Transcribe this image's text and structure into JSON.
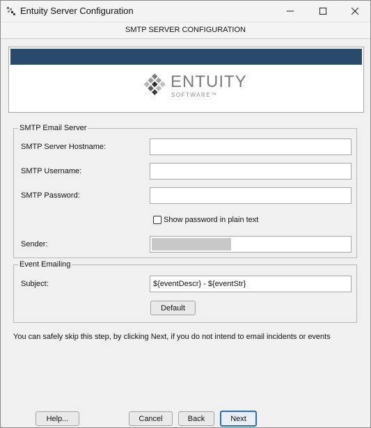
{
  "window": {
    "title": "Entuity Server Configuration",
    "icon": "entuity-app-icon"
  },
  "header": {
    "title": "SMTP SERVER CONFIGURATION"
  },
  "logo": {
    "brand": "ENTUITY",
    "sub": "SOFTWARE™",
    "bar_color": "#2a4a6b"
  },
  "smtp_group": {
    "legend": "SMTP Email Server",
    "hostname_label": "SMTP Server Hostname:",
    "hostname_value": "",
    "username_label": "SMTP Username:",
    "username_value": "",
    "password_label": "SMTP Password:",
    "password_value": "",
    "show_password_label": "Show password in plain text",
    "show_password_checked": false,
    "sender_label": "Sender:",
    "sender_value": ""
  },
  "event_group": {
    "legend": "Event Emailing",
    "subject_label": "Subject:",
    "subject_value": "${eventDescr} - ${eventStr}",
    "default_button": "Default"
  },
  "hint": "You can safely skip this step, by clicking Next, if you do not intend to email incidents or events",
  "footer": {
    "help_button": "Help...",
    "cancel_button": "Cancel",
    "back_button": "Back",
    "next_button": "Next"
  }
}
